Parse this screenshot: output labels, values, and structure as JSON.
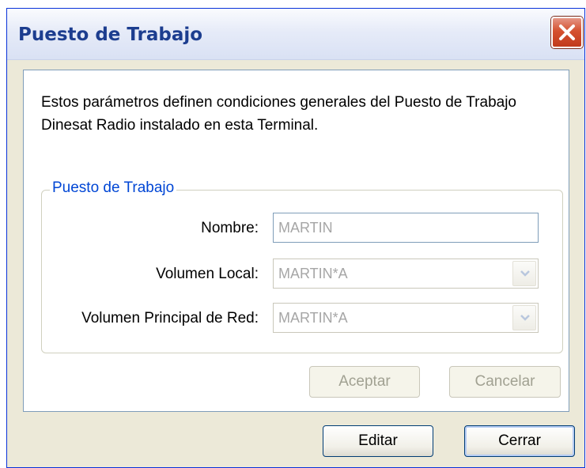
{
  "dialog": {
    "title": "Puesto de Trabajo",
    "close_icon": "close-icon",
    "description": "Estos parámetros definen condiciones generales del Puesto de Trabajo Dinesat Radio instalado en esta Terminal.",
    "group": {
      "legend": "Puesto de Trabajo",
      "nombre": {
        "label": "Nombre:",
        "value": "MARTIN"
      },
      "volumen_local": {
        "label": "Volumen Local:",
        "value": "MARTIN*A",
        "icon": "chevron-down-icon"
      },
      "volumen_principal": {
        "label": "Volumen Principal de Red:",
        "value": "MARTIN*A",
        "icon": "chevron-down-icon"
      }
    },
    "panel_buttons": {
      "aceptar": "Aceptar",
      "cancelar": "Cancelar"
    },
    "footer_buttons": {
      "editar": "Editar",
      "cerrar": "Cerrar"
    },
    "colors": {
      "title_text": "#1c3d8f",
      "legend_text": "#0046d5",
      "close_button": "#d5512f",
      "dialog_background": "#ece9d8"
    }
  }
}
